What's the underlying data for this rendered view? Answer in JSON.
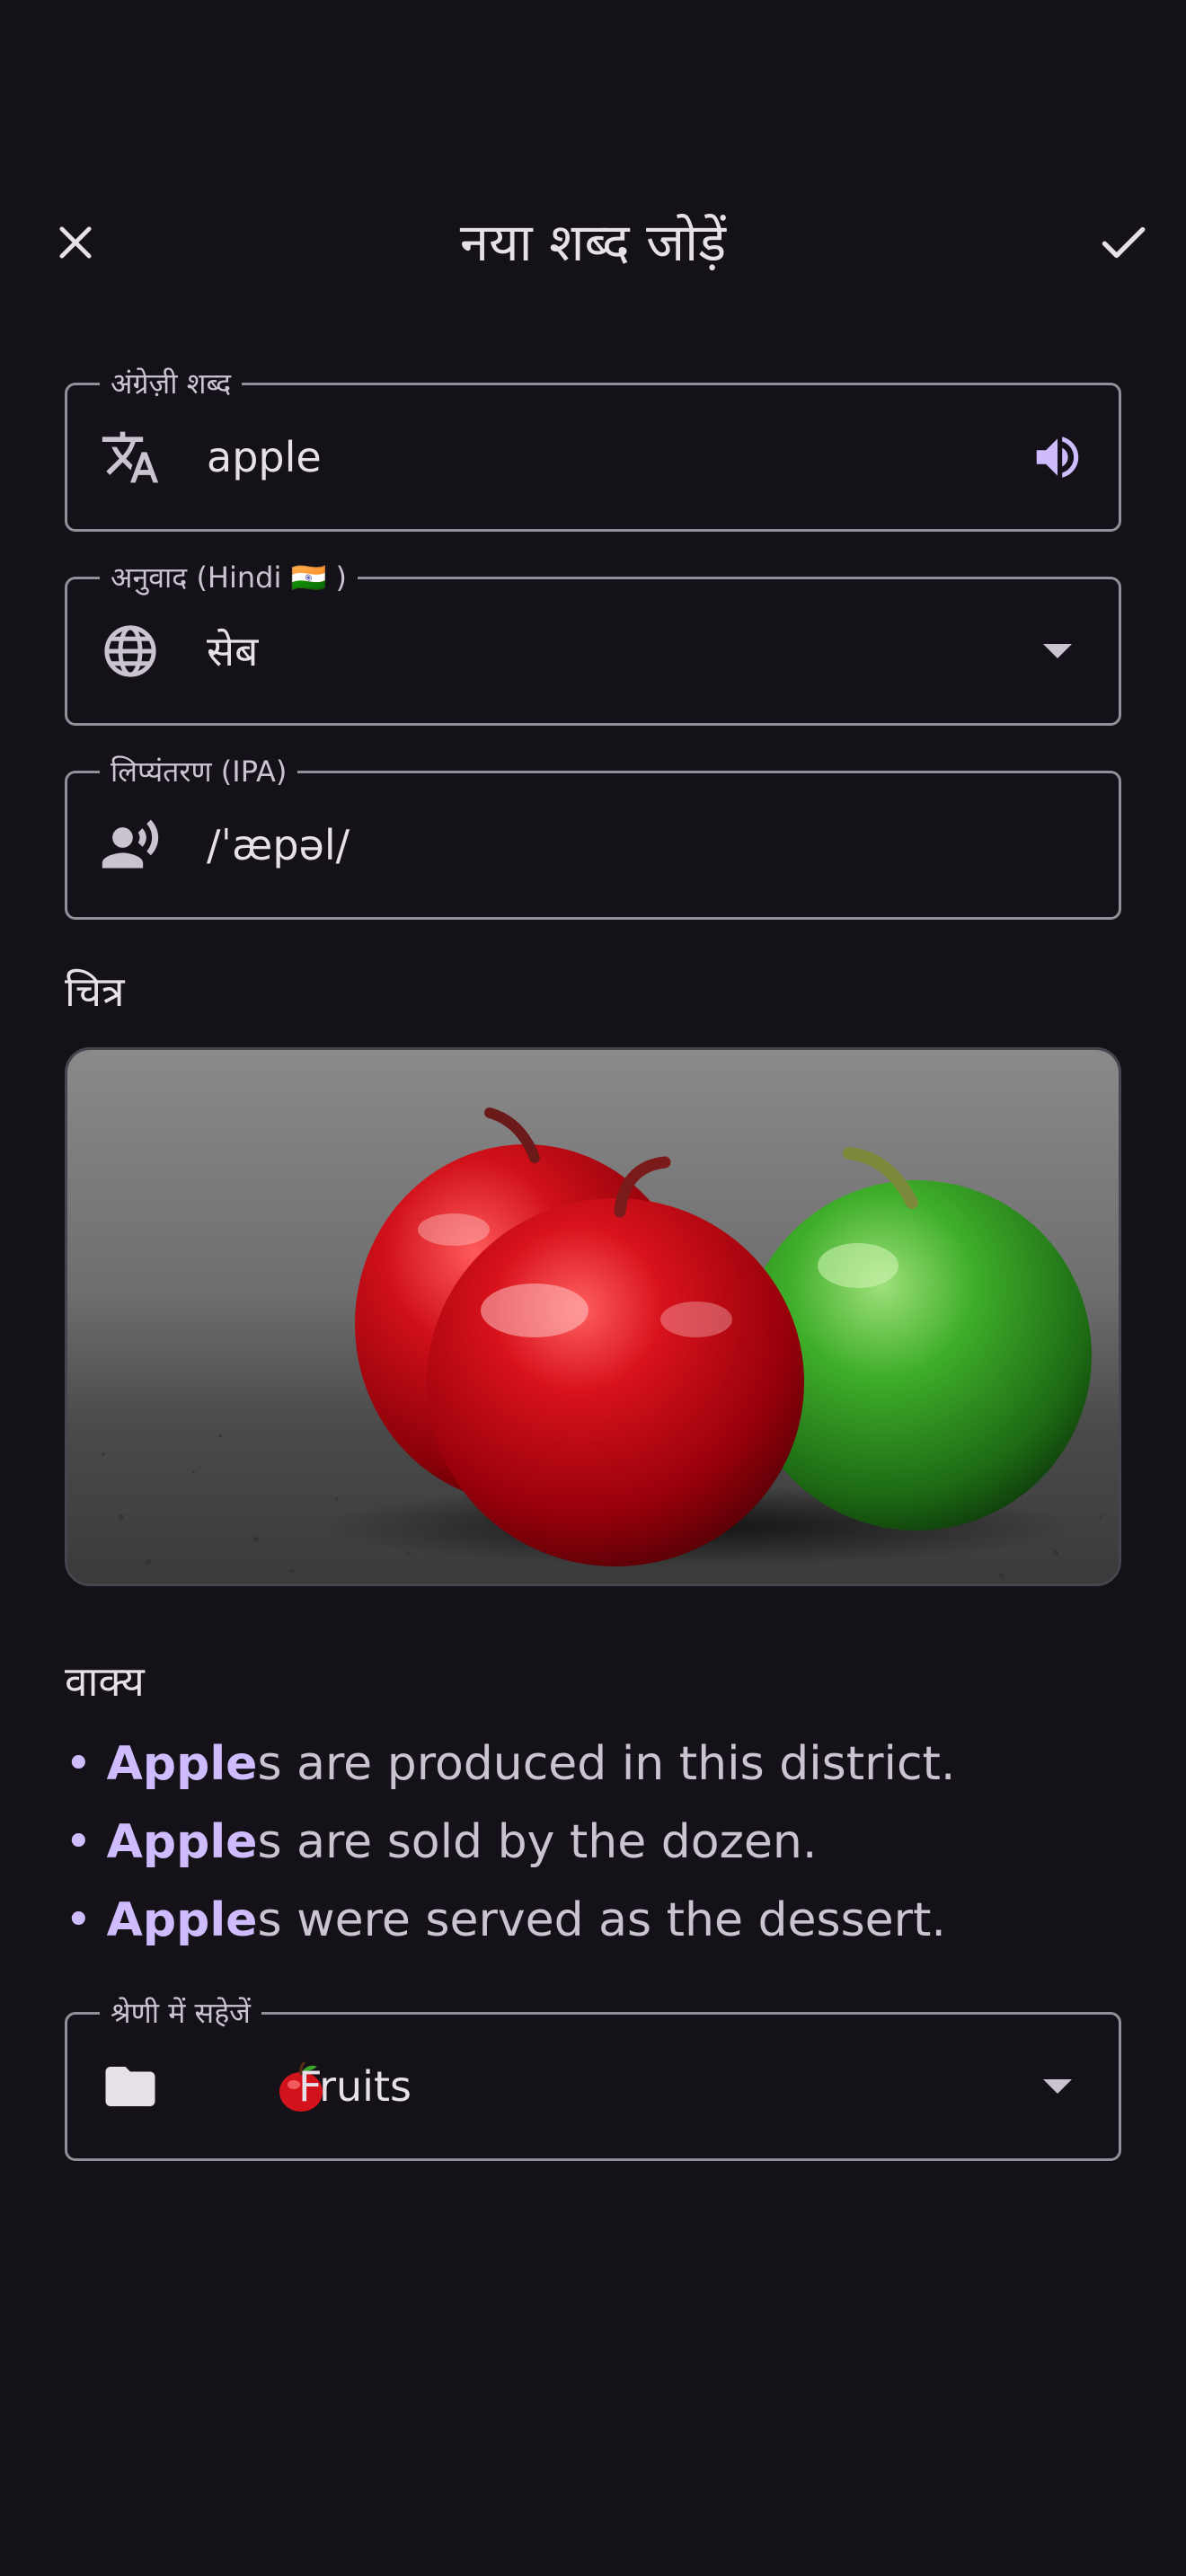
{
  "header": {
    "title": "नया शब्द जोड़ें",
    "close_icon": "close-icon",
    "save_icon": "check-icon"
  },
  "english_field": {
    "label": "अंग्रेज़ी शब्द",
    "value": "apple",
    "leading_icon": "translate-icon",
    "trailing_icon": "volume-up-icon"
  },
  "translation_field": {
    "label": "अनुवाद (Hindi 🇮🇳 )",
    "value": "सेब",
    "leading_icon": "globe-icon",
    "trailing_icon": "dropdown-arrow-icon"
  },
  "ipa_field": {
    "label": "लिप्यंतरण (IPA)",
    "value": "/ˈæpəl/",
    "leading_icon": "record-voice-icon"
  },
  "image_section": {
    "title": "चित्र"
  },
  "sentences_section": {
    "title": "वाक्य",
    "items": [
      {
        "highlight": "Apple",
        "rest": "s are produced in this district."
      },
      {
        "highlight": "Apple",
        "rest": "s are sold by the dozen."
      },
      {
        "highlight": "Apple",
        "rest": "s were served as the dessert."
      }
    ]
  },
  "category_field": {
    "label": "श्रेणी में सहेजें",
    "value": "Fruits",
    "emoji": "🍎",
    "leading_icon": "folder-icon",
    "trailing_icon": "dropdown-arrow-icon"
  },
  "colors": {
    "background": "#141218",
    "accent": "#cfbcff",
    "outline": "#938f99",
    "text": "#e6e0e9"
  }
}
